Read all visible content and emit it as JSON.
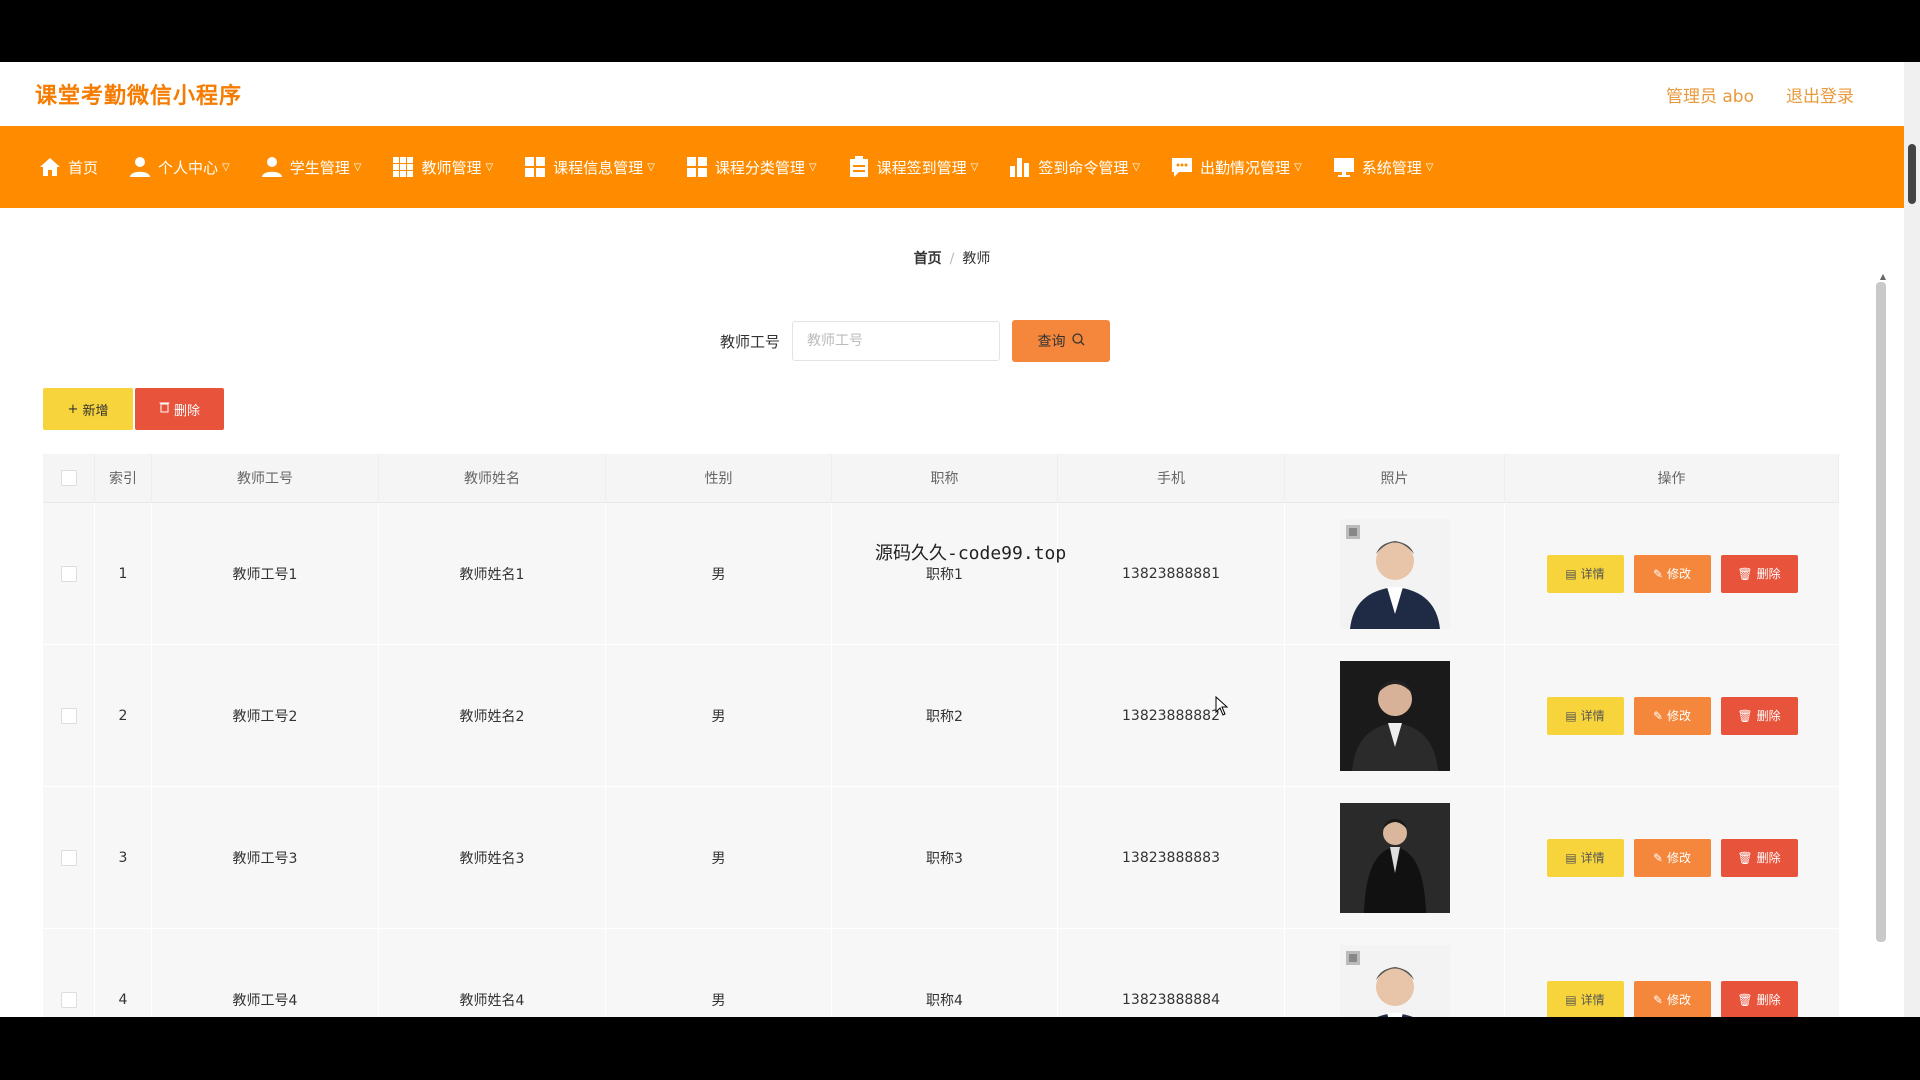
{
  "app": {
    "title": "课堂考勤微信小程序",
    "user": "管理员 abo",
    "logout": "退出登录"
  },
  "nav": [
    {
      "label": "首页",
      "icon": "home-icon",
      "chevron": false
    },
    {
      "label": "个人中心",
      "icon": "user-icon",
      "chevron": true
    },
    {
      "label": "学生管理",
      "icon": "user-icon",
      "chevron": true
    },
    {
      "label": "教师管理",
      "icon": "grid-icon",
      "chevron": true
    },
    {
      "label": "课程信息管理",
      "icon": "grid-icon",
      "chevron": true
    },
    {
      "label": "课程分类管理",
      "icon": "grid-icon",
      "chevron": true
    },
    {
      "label": "课程签到管理",
      "icon": "clipboard-icon",
      "chevron": true
    },
    {
      "label": "签到命令管理",
      "icon": "bar-chart-icon",
      "chevron": true
    },
    {
      "label": "出勤情况管理",
      "icon": "message-icon",
      "chevron": true
    },
    {
      "label": "系统管理",
      "icon": "monitor-icon",
      "chevron": true
    }
  ],
  "breadcrumb": {
    "home": "首页",
    "current": "教师"
  },
  "search": {
    "label": "教师工号",
    "placeholder": "教师工号",
    "button": "查询"
  },
  "actions": {
    "add": "新增",
    "delete": "删除"
  },
  "table": {
    "headers": {
      "index": "索引",
      "no": "教师工号",
      "name": "教师姓名",
      "sex": "性别",
      "title": "职称",
      "phone": "手机",
      "photo": "照片",
      "ops": "操作"
    },
    "rows": [
      {
        "index": "1",
        "no": "教师工号1",
        "name": "教师姓名1",
        "sex": "男",
        "title": "职称1",
        "phone": "13823888881"
      },
      {
        "index": "2",
        "no": "教师工号2",
        "name": "教师姓名2",
        "sex": "男",
        "title": "职称2",
        "phone": "13823888882"
      },
      {
        "index": "3",
        "no": "教师工号3",
        "name": "教师姓名3",
        "sex": "男",
        "title": "职称3",
        "phone": "13823888883"
      },
      {
        "index": "4",
        "no": "教师工号4",
        "name": "教师姓名4",
        "sex": "男",
        "title": "职称4",
        "phone": "13823888884"
      }
    ],
    "ops": {
      "detail": "详情",
      "edit": "修改",
      "delete": "删除"
    }
  },
  "overlay_text": "源码久久-code99.top",
  "colors": {
    "accent": "#ff8c00",
    "title": "#f57c00",
    "detail": "#f7d43c",
    "edit": "#f4873b",
    "delete": "#e8533b"
  }
}
